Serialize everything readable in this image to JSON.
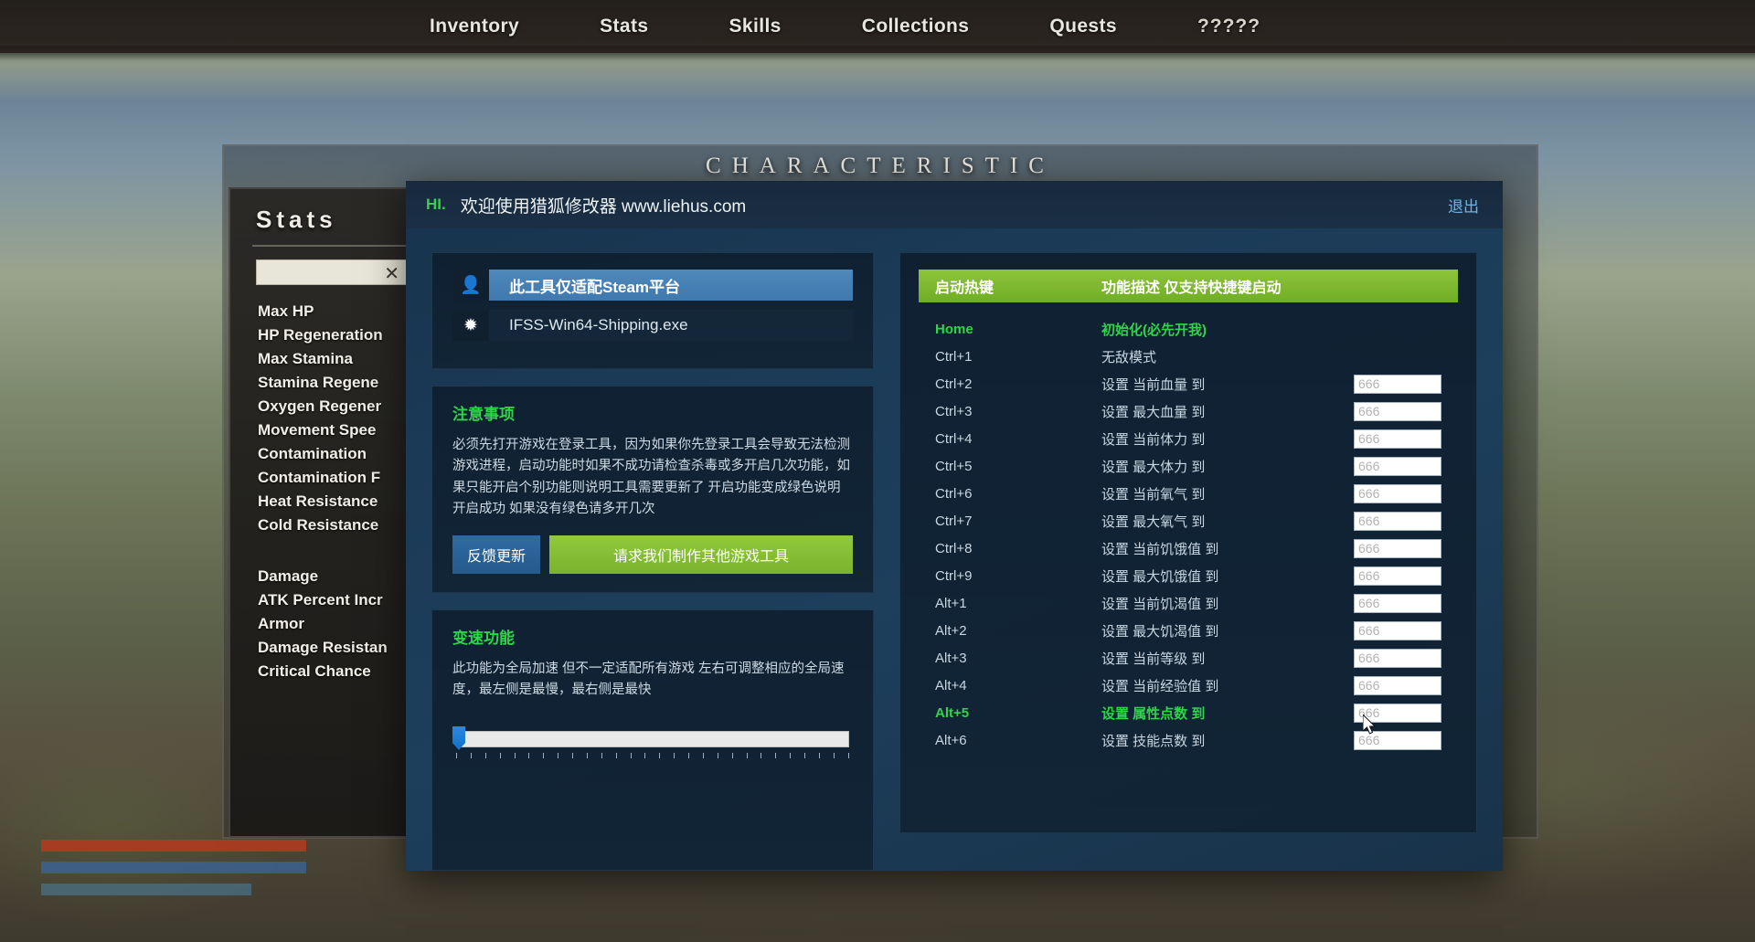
{
  "game": {
    "nav_tabs": [
      {
        "label": "Inventory"
      },
      {
        "label": "Stats"
      },
      {
        "label": "Skills"
      },
      {
        "label": "Collections"
      },
      {
        "label": "Quests"
      },
      {
        "label": "?????"
      }
    ],
    "characteristic_title": "CHARACTERISTIC",
    "stats_panel": {
      "title": "Stats",
      "search_value": "",
      "clear_icon": "✕",
      "items": [
        {
          "label": "Max HP",
          "gap": false
        },
        {
          "label": "HP Regeneration",
          "gap": false
        },
        {
          "label": "Max Stamina",
          "gap": false
        },
        {
          "label": "Stamina Regene",
          "gap": false
        },
        {
          "label": "Oxygen Regener",
          "gap": false
        },
        {
          "label": "Movement Spee",
          "gap": false
        },
        {
          "label": "Contamination",
          "gap": false
        },
        {
          "label": "Contamination F",
          "gap": false
        },
        {
          "label": "Heat Resistance",
          "gap": false
        },
        {
          "label": "Cold Resistance",
          "gap": false
        },
        {
          "label": "Damage",
          "gap": true
        },
        {
          "label": "ATK Percent Incr",
          "gap": false
        },
        {
          "label": "Armor",
          "gap": false
        },
        {
          "label": "Damage Resistan",
          "gap": false
        },
        {
          "label": "Critical Chance",
          "gap": false
        }
      ]
    }
  },
  "trainer": {
    "titlebar": {
      "hi": "HI.",
      "welcome": "欢迎使用猎狐修改器 www.liehus.com",
      "exit": "退出"
    },
    "process_card": {
      "rows": [
        {
          "icon": "person-icon",
          "glyph": "👤",
          "label": "此工具仅适配Steam平台",
          "selected": true
        },
        {
          "icon": "gear-icon",
          "glyph": "✹",
          "label": "IFSS-Win64-Shipping.exe",
          "selected": false
        }
      ]
    },
    "notes_card": {
      "heading": "注意事项",
      "body": "必须先打开游戏在登录工具，因为如果你先登录工具会导致无法检测游戏进程，启动功能时如果不成功请检查杀毒或多开启几次功能，如果只能开启个别功能则说明工具需要更新了 开启功能变成绿色说明开启成功 如果没有绿色请多开几次",
      "btn_feedback": "反馈更新",
      "btn_request": "请求我们制作其他游戏工具"
    },
    "speed_card": {
      "heading": "变速功能",
      "body": "此功能为全局加速 但不一定适配所有游戏 左右可调整相应的全局速度，最左侧是最慢，最右侧是最快",
      "slider_position": 0,
      "tick_count": 28
    },
    "hotkey_card": {
      "header_key": "启动热键",
      "header_desc": "功能描述 仅支持快捷键启动",
      "input_placeholder": "666",
      "rows": [
        {
          "key": "Home",
          "desc": "初始化(必先开我)",
          "active": true,
          "has_input": false
        },
        {
          "key": "Ctrl+1",
          "desc": "无敌模式",
          "active": false,
          "has_input": false
        },
        {
          "key": "Ctrl+2",
          "desc": "设置 当前血量 到",
          "active": false,
          "has_input": true
        },
        {
          "key": "Ctrl+3",
          "desc": "设置 最大血量 到",
          "active": false,
          "has_input": true
        },
        {
          "key": "Ctrl+4",
          "desc": "设置 当前体力 到",
          "active": false,
          "has_input": true
        },
        {
          "key": "Ctrl+5",
          "desc": "设置 最大体力 到",
          "active": false,
          "has_input": true
        },
        {
          "key": "Ctrl+6",
          "desc": "设置 当前氧气 到",
          "active": false,
          "has_input": true
        },
        {
          "key": "Ctrl+7",
          "desc": "设置 最大氧气 到",
          "active": false,
          "has_input": true
        },
        {
          "key": "Ctrl+8",
          "desc": "设置 当前饥饿值 到",
          "active": false,
          "has_input": true
        },
        {
          "key": "Ctrl+9",
          "desc": "设置 最大饥饿值 到",
          "active": false,
          "has_input": true
        },
        {
          "key": "Alt+1",
          "desc": "设置 当前饥渴值 到",
          "active": false,
          "has_input": true
        },
        {
          "key": "Alt+2",
          "desc": "设置 最大饥渴值 到",
          "active": false,
          "has_input": true
        },
        {
          "key": "Alt+3",
          "desc": "设置 当前等级 到",
          "active": false,
          "has_input": true
        },
        {
          "key": "Alt+4",
          "desc": "设置 当前经验值 到",
          "active": false,
          "has_input": true
        },
        {
          "key": "Alt+5",
          "desc": "设置 属性点数 到",
          "active": true,
          "has_input": true
        },
        {
          "key": "Alt+6",
          "desc": "设置 技能点数 到",
          "active": false,
          "has_input": true
        }
      ]
    }
  },
  "colors": {
    "accent_green": "#2fd44a",
    "header_green": "#8ec43a",
    "selected_blue": "#4f88bb",
    "exit_link": "#6fb4e8",
    "window_blue": "#1d3f5c"
  }
}
